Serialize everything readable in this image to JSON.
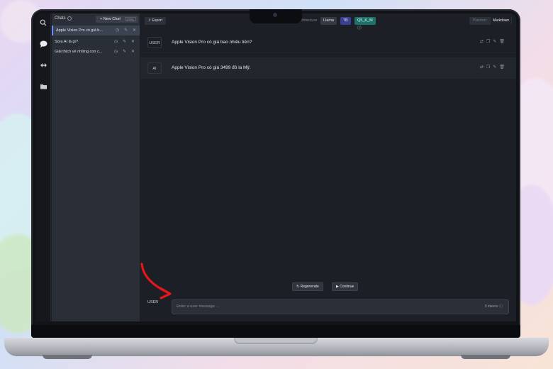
{
  "sidebar": {
    "title": "Chats",
    "new_chat_label": "+ New Chat",
    "new_chat_shortcut": "CTRL",
    "items": [
      {
        "title": "Apple Vision Pro có giá b...",
        "active": true
      },
      {
        "title": "Sora AI là gì?",
        "active": false
      },
      {
        "title": "Giải thích về những con c...",
        "active": false
      }
    ]
  },
  "topbar": {
    "export_label": "Export",
    "architecture_label": "Architecture",
    "architecture_value": "Llama",
    "size_badge": "7B",
    "quant_badge": "Q5_K_M",
    "view_options": [
      "Plaintext",
      "Markdown"
    ],
    "view_selected": "Markdown"
  },
  "messages": [
    {
      "role": "USER",
      "text": "Apple Vision Pro có giá bao nhiêu tiền?"
    },
    {
      "role": "AI",
      "text": "Apple Vision Pro có giá 3499 đô la Mỹ."
    }
  ],
  "actions": {
    "regenerate_label": "Regenerate",
    "continue_label": "Continue"
  },
  "composer": {
    "role": "USER",
    "placeholder": "Enter a user message ...",
    "tokens": "0 tokens"
  },
  "colors": {
    "accent": "#6a8cff",
    "arrow": "#e3171a",
    "quant_badge": "#1f6f6a",
    "size_badge": "#3b3f8f"
  }
}
